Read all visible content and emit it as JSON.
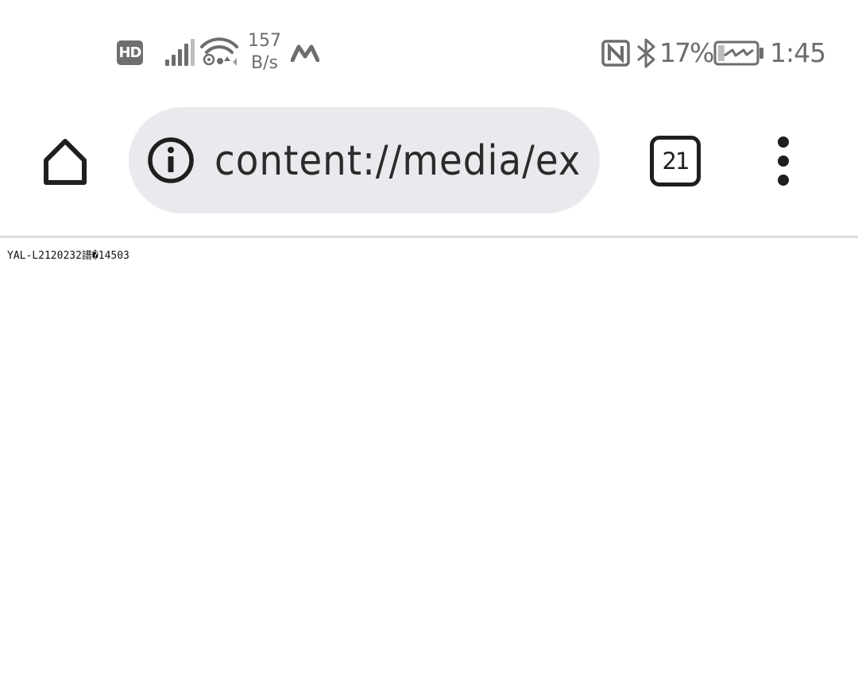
{
  "status_bar": {
    "hd_badge": "HD",
    "net_speed_value": "157",
    "net_speed_unit": "B/s",
    "battery_percent": "17%",
    "battery_level": 0.17,
    "battery_charging": true,
    "time": "1:45",
    "icons": [
      "hd-icon",
      "signal-icon",
      "wifi-icon",
      "m-icon",
      "nfc-icon",
      "bluetooth-icon",
      "battery-charging-icon"
    ]
  },
  "toolbar": {
    "url": "content://media/external/file/...",
    "url_visible": "content://media/ex",
    "tab_count": "21",
    "icons": [
      "home-icon",
      "info-icon",
      "tab-switcher-icon",
      "more-vert-icon"
    ]
  },
  "document": {
    "text": "YAL-L2120232譜�14503"
  },
  "colors": {
    "status_text": "#6d6d6d",
    "url_bar_bg": "#e9eaed",
    "icon_dark": "#1f1f1f",
    "divider": "#dedede"
  }
}
